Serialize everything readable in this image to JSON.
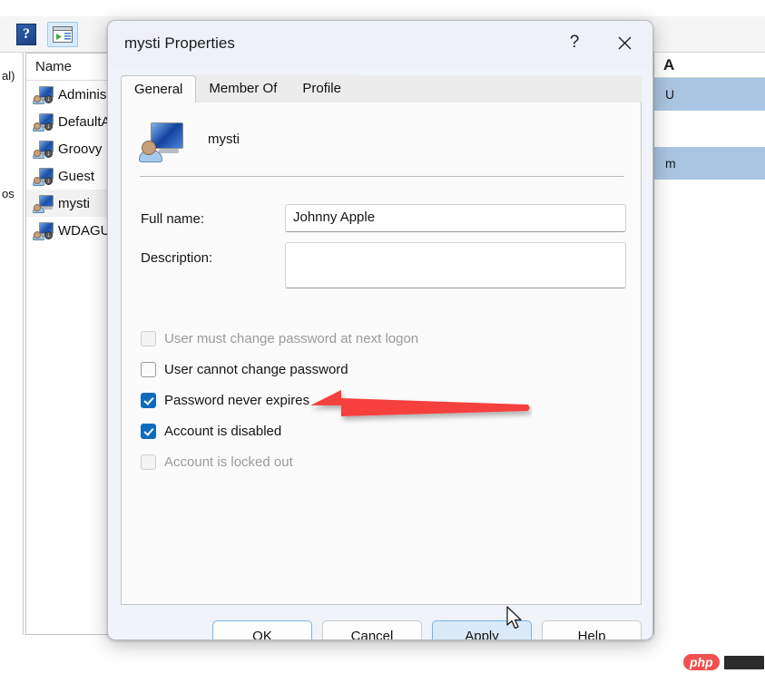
{
  "console": {
    "toolbar": {
      "help_icon": "help-icon",
      "help_glyph": "?",
      "show_pane_icon": "show-action-pane-icon"
    },
    "left_fragments": [
      "al)",
      "os"
    ],
    "list": {
      "column_header": "Name",
      "rows": [
        {
          "label": "Adminis",
          "selected": false
        },
        {
          "label": "DefaultA",
          "selected": false
        },
        {
          "label": "Groovy",
          "selected": false
        },
        {
          "label": "Guest",
          "selected": false
        },
        {
          "label": "mysti",
          "selected": true
        },
        {
          "label": "WDAGU",
          "selected": false
        }
      ]
    },
    "actions_pane": {
      "header": "A",
      "rows": [
        "U",
        "m"
      ]
    }
  },
  "dialog": {
    "title": "mysti Properties",
    "help_button": "?",
    "close_button": "×",
    "tabs": [
      {
        "label": "General",
        "active": true
      },
      {
        "label": "Member Of",
        "active": false
      },
      {
        "label": "Profile",
        "active": false
      }
    ],
    "header": {
      "icon": "user-account-icon",
      "account_name": "mysti"
    },
    "fields": [
      {
        "label": "Full name:",
        "value": "Johnny Apple"
      },
      {
        "label": "Description:",
        "value": ""
      }
    ],
    "checkboxes": [
      {
        "label": "User must change password at next logon",
        "checked": false,
        "enabled": false
      },
      {
        "label": "User cannot change password",
        "checked": false,
        "enabled": true
      },
      {
        "label": "Password never expires",
        "checked": true,
        "enabled": true
      },
      {
        "label": "Account is disabled",
        "checked": true,
        "enabled": true
      },
      {
        "label": "Account is locked out",
        "checked": false,
        "enabled": false
      }
    ],
    "buttons": [
      {
        "label": "OK",
        "style": "accent"
      },
      {
        "label": "Cancel",
        "style": "normal"
      },
      {
        "label": "Apply",
        "style": "hover"
      },
      {
        "label": "Help",
        "style": "normal"
      }
    ]
  },
  "annotation": {
    "arrow_color": "#F5403C",
    "arrow_name": "red-pointer-arrow",
    "points_at": "Account is disabled"
  },
  "watermark": {
    "text": "php"
  },
  "colors": {
    "accent": "#0f6cbd",
    "titlebar": "#eef2f8",
    "dialog_bg": "#f0f3f9",
    "arrow_red": "#F5403C",
    "highlight_row": "#aac5e2"
  }
}
